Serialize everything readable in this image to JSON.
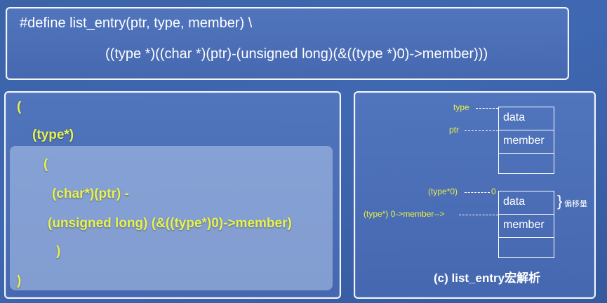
{
  "top": {
    "line1": "#define list_entry(ptr, type, member) \\",
    "line2": "((type *)((char *)(ptr)-(unsigned long)(&((type *)0)->member)))"
  },
  "left": {
    "l1": "(",
    "l2": "(type*)",
    "l3": "(",
    "l4": "(char*)(ptr) -",
    "l5": "(unsigned long) (&((type*)0)->member)",
    "l6": ")",
    "l7": ")"
  },
  "diagram": {
    "top_struct": {
      "type_label": "type",
      "ptr_label": "ptr",
      "cell1": "data",
      "cell2": "member"
    },
    "bottom_struct": {
      "type0_label": "(type*0)",
      "zero_label": "0",
      "member_label": "(type*) 0->member-->",
      "cell1": "data",
      "cell2": "member",
      "offset_note": "偏移量"
    },
    "caption": "(c) list_entry宏解析"
  }
}
